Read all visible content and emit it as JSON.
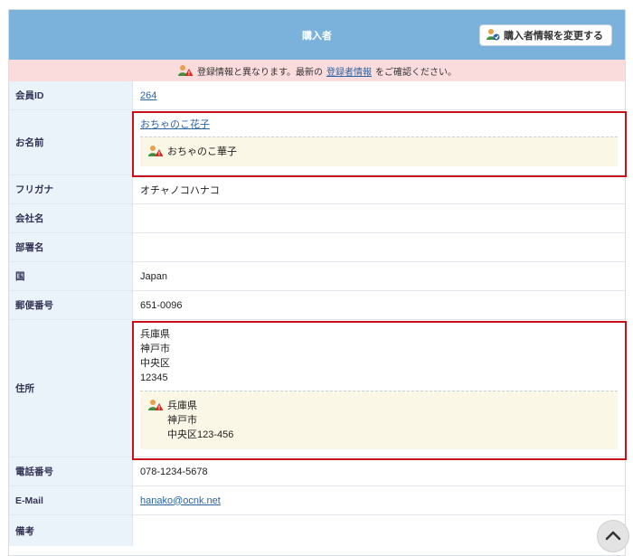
{
  "header": {
    "title": "購入者",
    "change_button": "購入者情報を変更する"
  },
  "alert": {
    "prefix": "登録情報と異なります。最新の",
    "link": "登録者情報",
    "suffix": "をご確認ください。"
  },
  "rows": {
    "member_id": {
      "label": "会員ID",
      "value": "264"
    },
    "name": {
      "label": "お名前",
      "value": "おちゃのこ花子",
      "registered": "おちゃのこ華子"
    },
    "furigana": {
      "label": "フリガナ",
      "value": "オチャノコハナコ"
    },
    "company": {
      "label": "会社名",
      "value": ""
    },
    "department": {
      "label": "部署名",
      "value": ""
    },
    "country": {
      "label": "国",
      "value": "Japan"
    },
    "postal": {
      "label": "郵便番号",
      "value": "651-0096"
    },
    "address": {
      "label": "住所",
      "line1": "兵庫県",
      "line2": "神戸市",
      "line3": "中央区",
      "line4": "12345",
      "registered1": "兵庫県",
      "registered2": "神戸市",
      "registered3": "中央区123-456"
    },
    "phone": {
      "label": "電話番号",
      "value": "078-1234-5678"
    },
    "email": {
      "label": "E-Mail",
      "value": "hanako@ocnk.net"
    },
    "remarks": {
      "label": "備考",
      "value": ""
    }
  },
  "icons": {
    "change_button_icon": "user-edit-icon",
    "warning_icon": "user-warning-icon",
    "scroll_top_icon": "chevron-up-icon"
  },
  "colors": {
    "header_bg": "#7ab2dc",
    "alert_bg": "#fbdcdc",
    "label_bg": "#ebf3fa",
    "note_bg": "#faf7e6",
    "highlight_border": "#c8101a",
    "link": "#2a64a8"
  }
}
